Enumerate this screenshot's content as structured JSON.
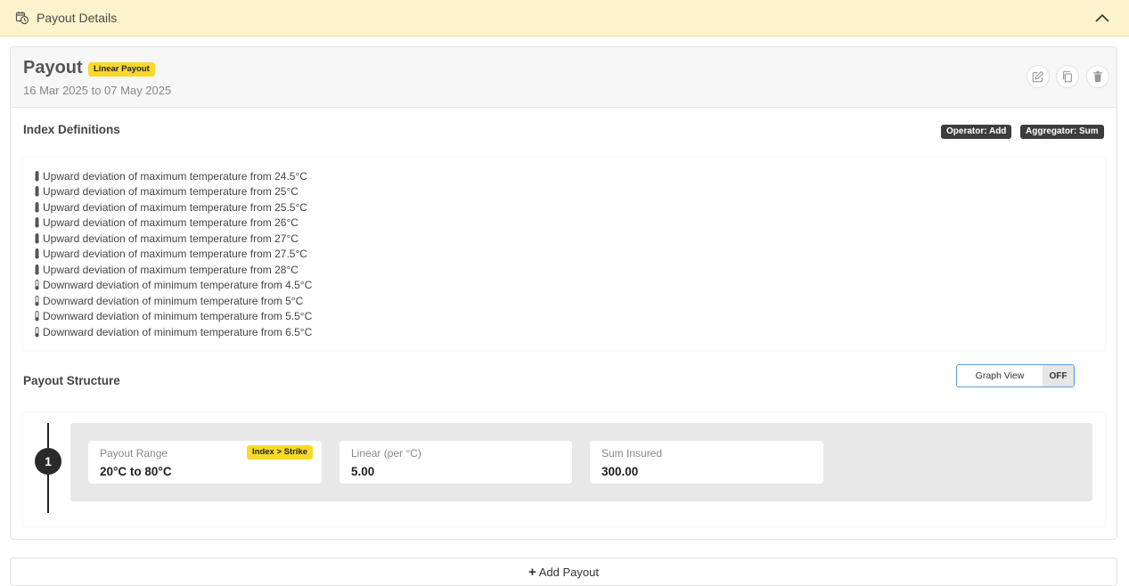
{
  "section": {
    "title": "Payout Details"
  },
  "payout": {
    "title": "Payout",
    "type_badge": "Linear Payout",
    "dates": "16 Mar 2025 to 07 May 2025"
  },
  "index_definitions": {
    "heading": "Index Definitions",
    "operator_badge": "Operator: Add",
    "aggregator_badge": "Aggregator: Sum",
    "items": [
      {
        "text": "Upward deviation of maximum temperature from 24.5°C",
        "icon": "thermometer-high-icon"
      },
      {
        "text": "Upward deviation of maximum temperature from 25°C",
        "icon": "thermometer-high-icon"
      },
      {
        "text": "Upward deviation of maximum temperature from 25.5°C",
        "icon": "thermometer-high-icon"
      },
      {
        "text": "Upward deviation of maximum temperature from 26°C",
        "icon": "thermometer-high-icon"
      },
      {
        "text": "Upward deviation of maximum temperature from 27°C",
        "icon": "thermometer-high-icon"
      },
      {
        "text": "Upward deviation of maximum temperature from 27.5°C",
        "icon": "thermometer-high-icon"
      },
      {
        "text": "Upward deviation of maximum temperature from 28°C",
        "icon": "thermometer-high-icon"
      },
      {
        "text": "Downward deviation of minimum temperature from 4.5°C",
        "icon": "thermometer-low-icon"
      },
      {
        "text": "Downward deviation of minimum temperature from 5°C",
        "icon": "thermometer-low-icon"
      },
      {
        "text": "Downward deviation of minimum temperature from 5.5°C",
        "icon": "thermometer-low-icon"
      },
      {
        "text": "Downward deviation of minimum temperature from 6.5°C",
        "icon": "thermometer-low-icon"
      }
    ]
  },
  "payout_structure": {
    "heading": "Payout Structure",
    "graph_toggle": {
      "label": "Graph View",
      "state": "OFF"
    },
    "steps": [
      {
        "number": "1",
        "range_label": "Payout Range",
        "range_badge": "Index > Strike",
        "range_value": "20°C to 80°C",
        "rate_label": "Linear (per °C)",
        "rate_value": "5.00",
        "sum_label": "Sum Insured",
        "sum_value": "300.00"
      }
    ]
  },
  "add_payout": {
    "label": "Add Payout"
  },
  "colors": {
    "header_bg": "#fcf3cc",
    "badge_yellow": "#f8d92a",
    "badge_dark": "#3d3d3d",
    "toggle_border": "#5b9bd5"
  }
}
